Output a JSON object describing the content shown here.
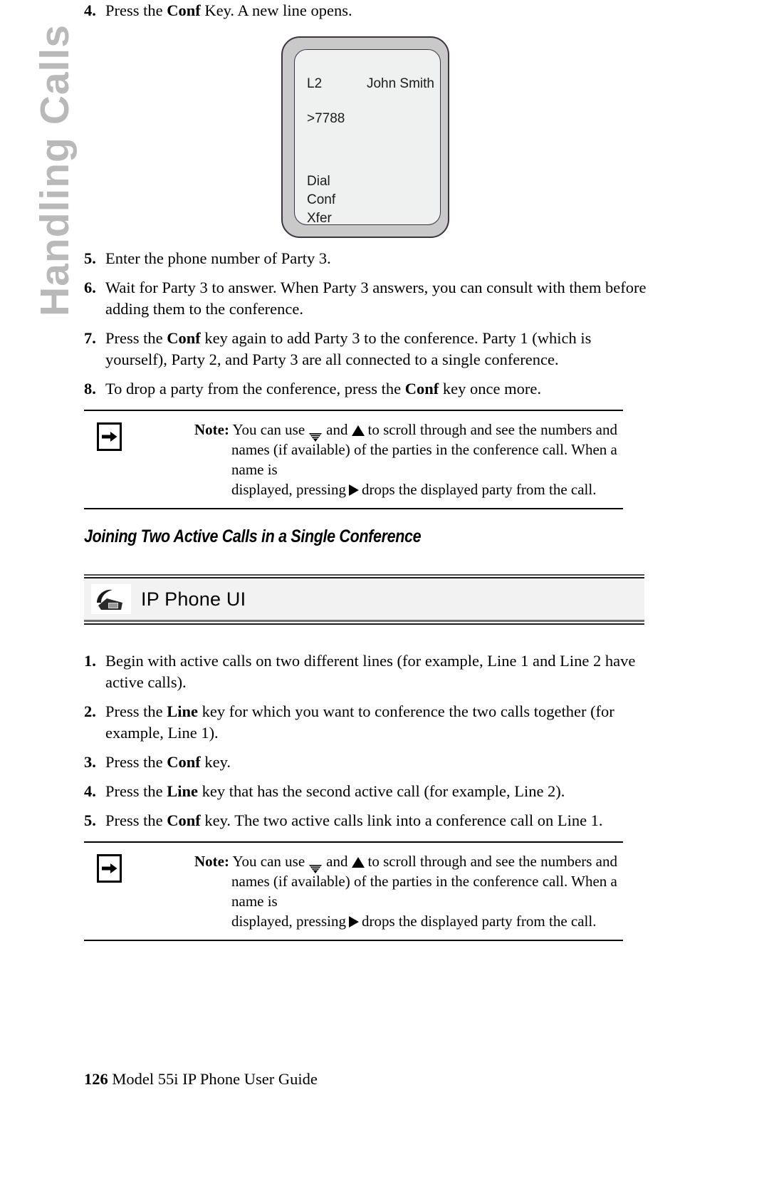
{
  "side_tab": {
    "label": "Handling Calls"
  },
  "top_steps": [
    {
      "num": "4.",
      "parts": [
        {
          "t": "Press the ",
          "b": false
        },
        {
          "t": "Conf",
          "b": true
        },
        {
          "t": " Key. A new line opens.",
          "b": false
        }
      ]
    }
  ],
  "phone_figure": {
    "line_label": "L2",
    "caller_name": "John Smith",
    "dialed_number": ">7788",
    "softkeys": [
      "Dial",
      "Conf",
      "Xfer"
    ]
  },
  "steps_after_figure": [
    {
      "num": "5.",
      "parts": [
        {
          "t": "Enter the phone number of Party 3.",
          "b": false
        }
      ]
    },
    {
      "num": "6.",
      "parts": [
        {
          "t": "Wait for Party 3 to answer. When Party 3 answers, you can consult with them before adding them to the conference.",
          "b": false
        }
      ]
    },
    {
      "num": "7.",
      "parts": [
        {
          "t": "Press the ",
          "b": false
        },
        {
          "t": "Conf",
          "b": true
        },
        {
          "t": " key again to add Party 3 to the conference. Party 1 (which is yourself), Party 2, and Party 3 are all connected to a single conference.",
          "b": false
        }
      ]
    },
    {
      "num": "8.",
      "parts": [
        {
          "t": "To drop a party from the conference, press the ",
          "b": false
        },
        {
          "t": "Conf",
          "b": true
        },
        {
          "t": " key once more.",
          "b": false
        }
      ]
    }
  ],
  "note": {
    "icon_name": "arrow-right-boxed-icon",
    "label": "Note:",
    "seg1": "You can use",
    "down_icon": "scroll-down-icon",
    "seg2": "and",
    "up_icon": "scroll-up-icon",
    "seg3": "to scroll through and see the numbers and",
    "line2": "names (if available) of the parties in the conference call. When a name is",
    "line3a": "displayed, pressing",
    "right_icon": "right-arrow-icon",
    "line3b": "drops the displayed party from the call."
  },
  "section": {
    "heading": "Joining Two Active Calls in a Single Conference"
  },
  "ui_banner": {
    "icon_name": "desk-phone-icon",
    "label": "IP Phone UI"
  },
  "ui_steps": [
    {
      "num": "1.",
      "parts": [
        {
          "t": "Begin with active calls on two different lines (for example, Line 1 and Line 2 have active calls).",
          "b": false
        }
      ]
    },
    {
      "num": "2.",
      "parts": [
        {
          "t": "Press the ",
          "b": false
        },
        {
          "t": "Line",
          "b": true
        },
        {
          "t": " key for which you want to conference the two calls together (for example, Line 1).",
          "b": false
        }
      ]
    },
    {
      "num": "3.",
      "parts": [
        {
          "t": "Press the ",
          "b": false
        },
        {
          "t": "Conf",
          "b": true
        },
        {
          "t": " key.",
          "b": false
        }
      ]
    },
    {
      "num": "4.",
      "parts": [
        {
          "t": "Press the ",
          "b": false
        },
        {
          "t": "Line",
          "b": true
        },
        {
          "t": " key that has the second active call (for example, Line 2).",
          "b": false
        }
      ]
    },
    {
      "num": "5.",
      "parts": [
        {
          "t": "Press the ",
          "b": false
        },
        {
          "t": "Conf",
          "b": true
        },
        {
          "t": " key. The two active calls link into a conference call on Line 1.",
          "b": false
        }
      ]
    }
  ],
  "footer": {
    "page_number": "126",
    "guide_title": "Model 55i IP Phone User Guide"
  },
  "colors": {
    "side_tab_gray": "#b9b9b9",
    "phone_body_gray": "#c9c9c9",
    "phone_lcd": "#eef1f0",
    "banner_bg": "#f2f2f2"
  }
}
